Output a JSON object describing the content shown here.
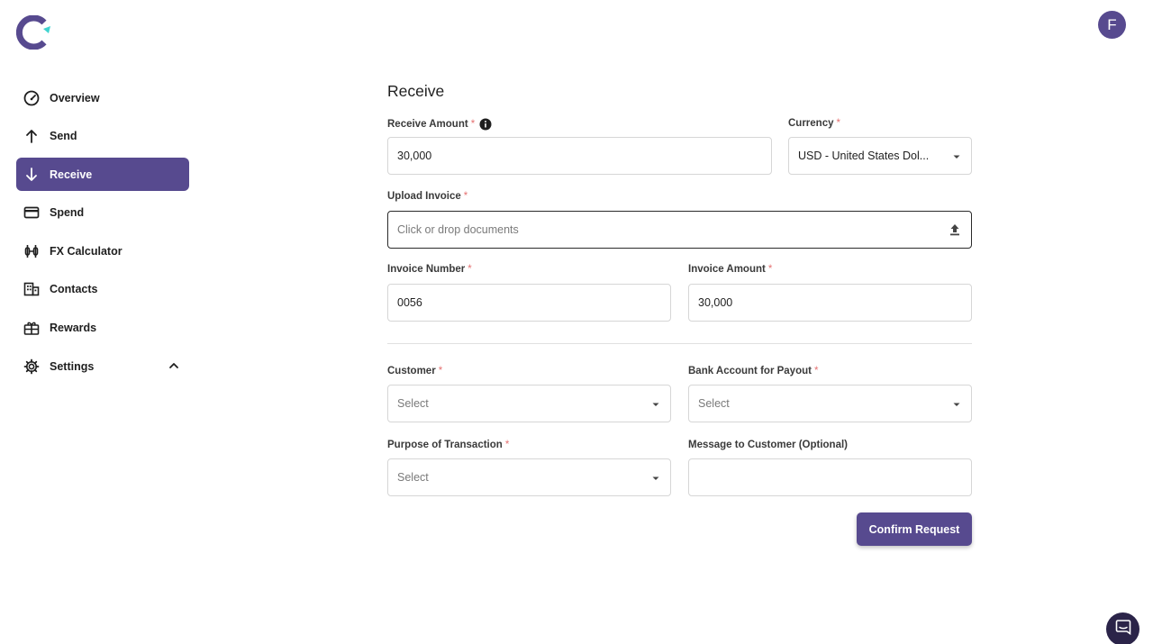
{
  "brand": {
    "accent": "#574a8f",
    "logo_cyan": "#3fd4d0"
  },
  "user": {
    "avatar_initial": "F"
  },
  "sidebar": {
    "items": [
      {
        "label": "Overview",
        "icon": "speedometer-icon",
        "active": false
      },
      {
        "label": "Send",
        "icon": "arrow-up-icon",
        "active": false
      },
      {
        "label": "Receive",
        "icon": "arrow-down-icon",
        "active": true
      },
      {
        "label": "Spend",
        "icon": "credit-card-icon",
        "active": false
      },
      {
        "label": "FX Calculator",
        "icon": "currency-exchange-icon",
        "active": false
      },
      {
        "label": "Contacts",
        "icon": "building-icon",
        "active": false
      },
      {
        "label": "Rewards",
        "icon": "gift-icon",
        "active": false
      },
      {
        "label": "Settings",
        "icon": "gear-icon",
        "active": false,
        "expand_icon": "chevron-up-icon"
      }
    ]
  },
  "form": {
    "title": "Receive",
    "required_mark": "*",
    "receive_amount": {
      "label": "Receive Amount",
      "value": "30,000"
    },
    "currency": {
      "label": "Currency",
      "value": "USD - United States Dol..."
    },
    "upload_invoice": {
      "label": "Upload Invoice",
      "placeholder": "Click or drop documents"
    },
    "invoice_number": {
      "label": "Invoice Number",
      "value": "0056"
    },
    "invoice_amount": {
      "label": "Invoice Amount",
      "value": "30,000"
    },
    "customer": {
      "label": "Customer",
      "placeholder": "Select"
    },
    "bank_account": {
      "label": "Bank Account for Payout",
      "placeholder": "Select"
    },
    "purpose": {
      "label": "Purpose of Transaction",
      "placeholder": "Select"
    },
    "message": {
      "label": "Message to Customer (Optional)",
      "value": ""
    },
    "confirm_label": "Confirm Request"
  }
}
